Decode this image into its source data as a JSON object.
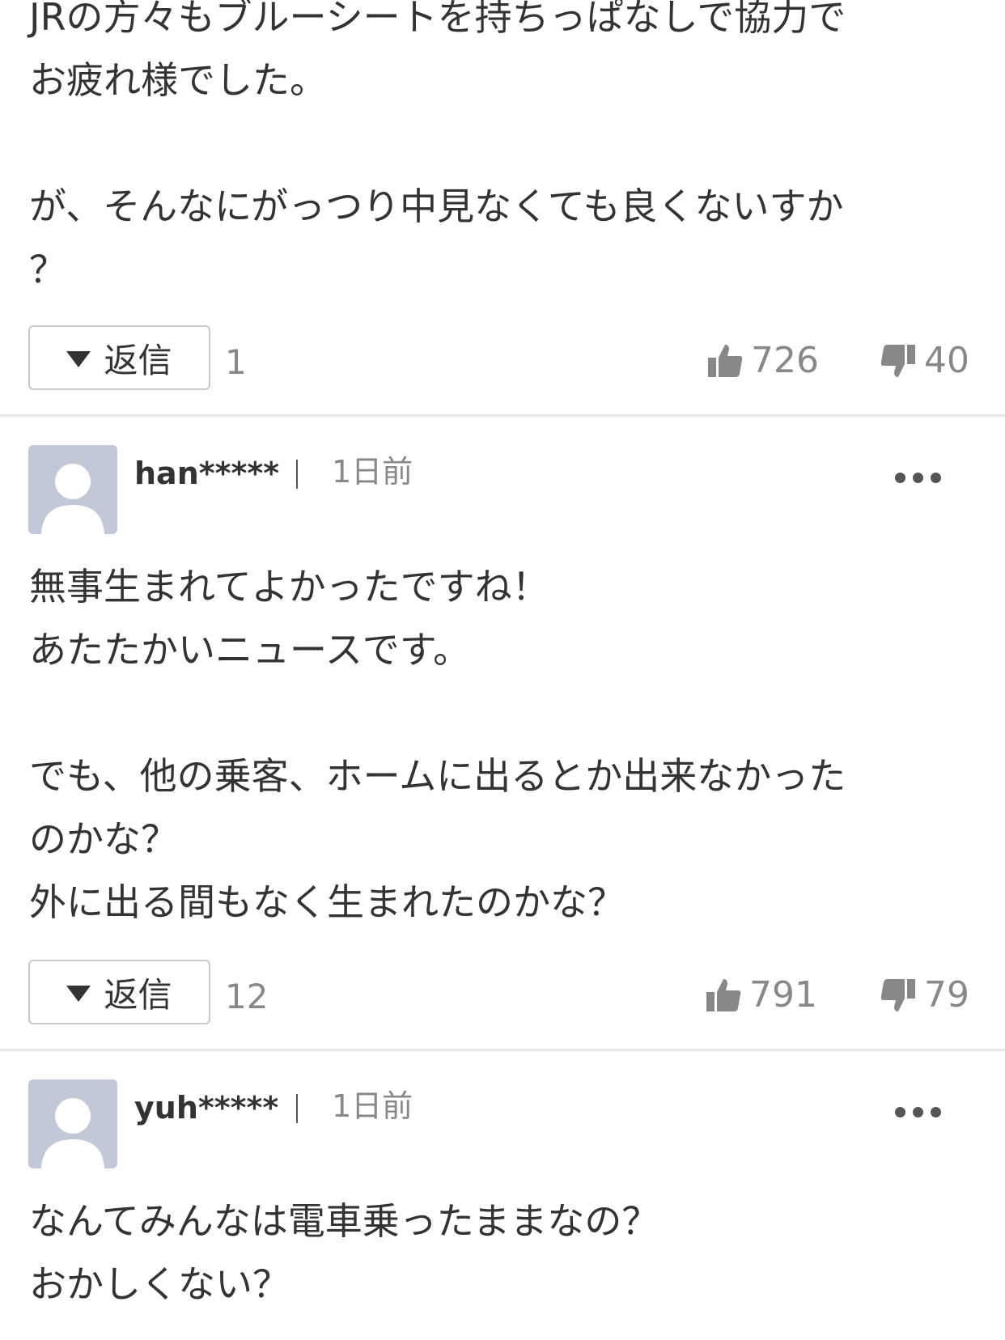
{
  "comments": [
    {
      "body": "JRの方々もブルーシートを持ちっぱなしで協力で\nお疲れ様でした。\n\nが、そんなにがっつり中見なくても良くないすか\n？",
      "reply_label": "返信",
      "reply_count": "1",
      "likes": "726",
      "dislikes": "40"
    },
    {
      "username": "han*****",
      "time": "1日前",
      "body": "無事生まれてよかったですね！\nあたたかいニュースです。\n\nでも、他の乗客、ホームに出るとか出来なかった\nのかな？\n外に出る間もなく生まれたのかな？",
      "reply_label": "返信",
      "reply_count": "12",
      "likes": "791",
      "dislikes": "79"
    },
    {
      "username": "yuh*****",
      "time": "1日前",
      "body": "なんてみんなは電車乗ったままなの？\nおかしくない？"
    }
  ],
  "icons": {
    "thumbs_up": "thumbs-up-icon",
    "thumbs_down": "thumbs-down-icon",
    "avatar": "default-avatar-icon",
    "more": "more-options-icon",
    "reply_toggle": "triangle-down-icon"
  },
  "colors": {
    "text": "#333333",
    "muted": "#888888",
    "avatar_bg": "#c3c8d6",
    "divider": "#e6e6e6"
  }
}
